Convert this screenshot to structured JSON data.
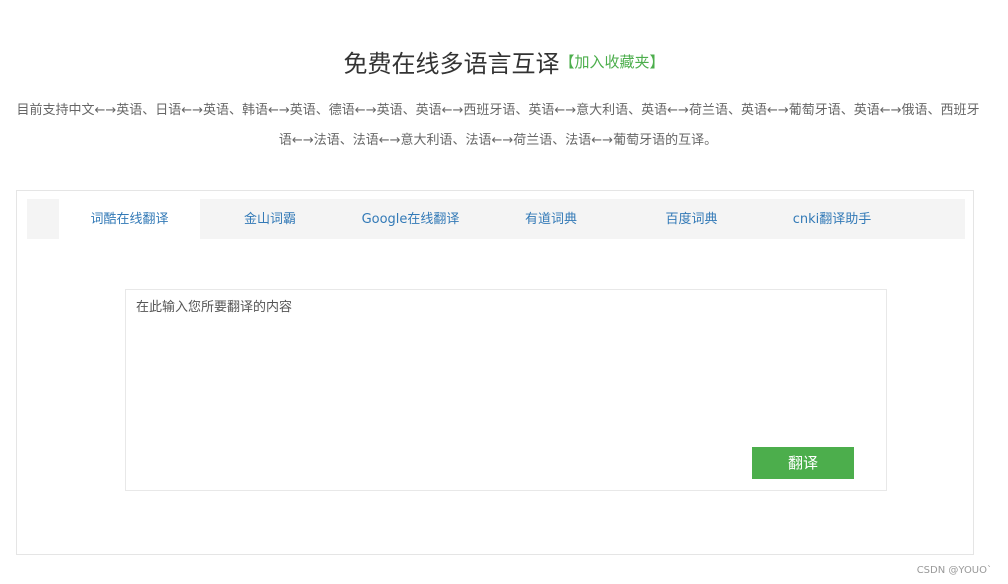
{
  "header": {
    "title": "免费在线多语言互译",
    "bookmark_link": "【加入收藏夹】"
  },
  "description": "目前支持中文←→英语、日语←→英语、韩语←→英语、德语←→英语、英语←→西班牙语、英语←→意大利语、英语←→荷兰语、英语←→葡萄牙语、英语←→俄语、西班牙语←→法语、法语←→意大利语、法语←→荷兰语、法语←→葡萄牙语的互译。",
  "tabs": [
    {
      "label": "词酷在线翻译",
      "active": true
    },
    {
      "label": "金山词霸",
      "active": false
    },
    {
      "label": "Google在线翻译",
      "active": false
    },
    {
      "label": "有道词典",
      "active": false
    },
    {
      "label": "百度词典",
      "active": false
    },
    {
      "label": "cnki翻译助手",
      "active": false
    }
  ],
  "input": {
    "placeholder": "在此输入您所要翻译的内容",
    "value": ""
  },
  "translate_button": "翻译",
  "watermark": "CSDN @YOUO`"
}
